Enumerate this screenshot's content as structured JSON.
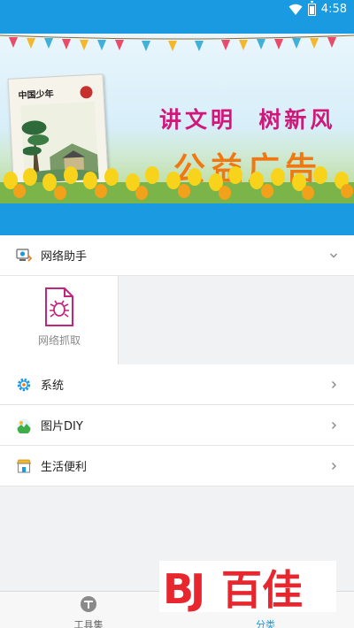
{
  "status_bar": {
    "time": "4:58",
    "bg_color": "#1a9ae0"
  },
  "banner": {
    "poster_title": "中国少年",
    "slogan_line1": "讲文明  树新风",
    "slogan_line2": "公益广告"
  },
  "sections": {
    "network": {
      "label": "网络助手",
      "icon": "network-monitor-icon",
      "state": "expanded"
    },
    "network_tiles": [
      {
        "label": "网络抓取",
        "icon": "bug-document-icon"
      }
    ],
    "system": {
      "label": "系统",
      "icon": "gear-icon"
    },
    "image_diy": {
      "label": "图片DIY",
      "icon": "landscape-image-icon"
    },
    "life": {
      "label": "生活便利",
      "icon": "storefront-icon"
    }
  },
  "bottom_nav": {
    "tabs": [
      {
        "label": "工具集",
        "icon": "toolbox-icon",
        "active": false
      },
      {
        "label": "分类",
        "icon": "category-icon",
        "active": true
      }
    ]
  },
  "watermark": {
    "logo": "BJ百佳"
  },
  "colors": {
    "accent": "#1a9ae0",
    "slogan_pink": "#d2177a",
    "slogan_orange": "#f07810",
    "tile_icon": "#c2257e"
  }
}
